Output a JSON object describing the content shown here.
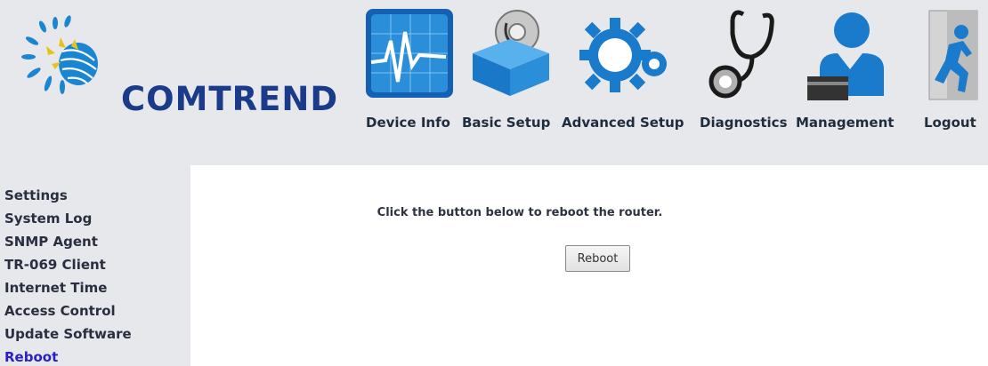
{
  "brand": {
    "name": "COMTREND"
  },
  "nav": {
    "items": [
      {
        "label": "Device Info",
        "icon": "device-info-icon"
      },
      {
        "label": "Basic Setup",
        "icon": "basic-setup-icon"
      },
      {
        "label": "Advanced Setup",
        "icon": "advanced-setup-icon"
      },
      {
        "label": "Diagnostics",
        "icon": "diagnostics-icon"
      },
      {
        "label": "Management",
        "icon": "management-icon"
      },
      {
        "label": "Logout",
        "icon": "logout-icon"
      }
    ]
  },
  "sidebar": {
    "items": [
      {
        "label": "Settings"
      },
      {
        "label": "System Log"
      },
      {
        "label": "SNMP Agent"
      },
      {
        "label": "TR-069 Client"
      },
      {
        "label": "Internet Time"
      },
      {
        "label": "Access Control"
      },
      {
        "label": "Update Software"
      },
      {
        "label": "Reboot",
        "active": true
      }
    ]
  },
  "main": {
    "message": "Click the button below to reboot the router.",
    "reboot_label": "Reboot"
  },
  "colors": {
    "background": "#e7e8ec",
    "content_background": "#ffffff",
    "brand_blue": "#1a3a8a",
    "icon_blue": "#1a86d2",
    "active_link": "#2a20c8"
  }
}
